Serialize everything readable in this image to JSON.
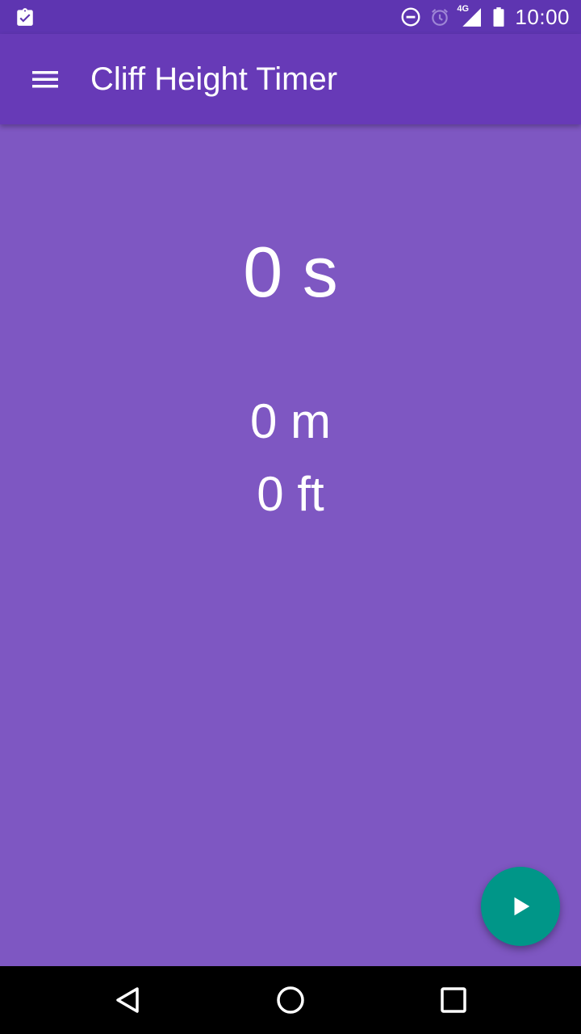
{
  "status_bar": {
    "time": "10:00",
    "network": "4G",
    "icons": [
      "clipboard-check-icon",
      "do-not-disturb-icon",
      "alarm-icon",
      "signal-icon",
      "battery-icon"
    ]
  },
  "app_bar": {
    "title": "Cliff Height Timer",
    "menu_icon": "menu-icon"
  },
  "readouts": {
    "time": "0 s",
    "meters": "0 m",
    "feet": "0 ft"
  },
  "fab": {
    "icon": "play-icon",
    "color": "#009688"
  },
  "navigation": {
    "buttons": [
      "back-icon",
      "home-icon",
      "recents-icon"
    ]
  },
  "colors": {
    "status_bar": "#5e35b1",
    "app_bar": "#673ab7",
    "background": "#7e57c2",
    "accent": "#009688"
  }
}
